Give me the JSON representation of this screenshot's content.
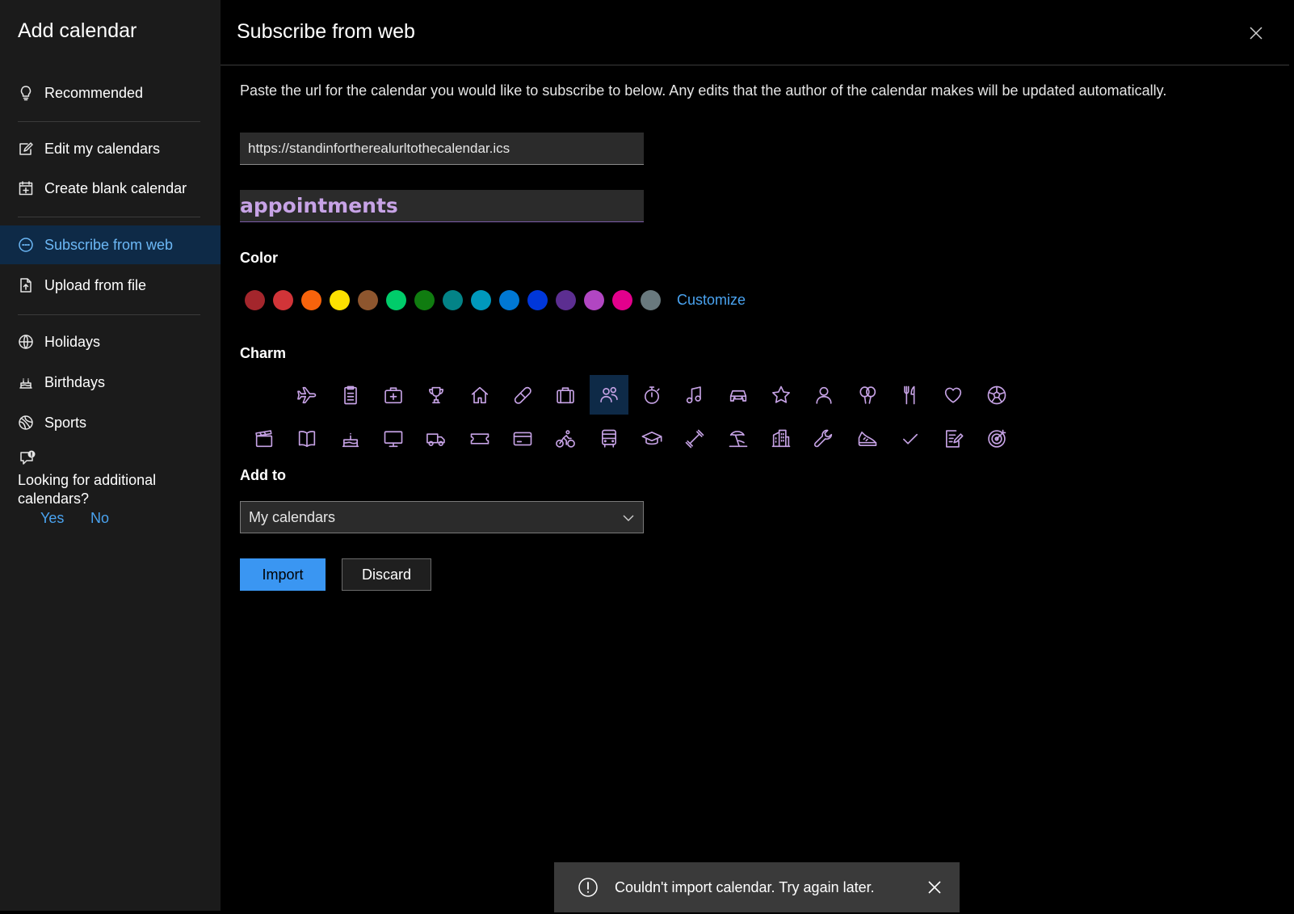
{
  "sidebar": {
    "title": "Add calendar",
    "items": [
      {
        "label": "Recommended",
        "icon": "lightbulb-icon"
      },
      {
        "label": "Edit my calendars",
        "icon": "edit-icon"
      },
      {
        "label": "Create blank calendar",
        "icon": "calendar-add-icon"
      },
      {
        "label": "Subscribe from web",
        "icon": "web-icon",
        "active": true
      },
      {
        "label": "Upload from file",
        "icon": "file-upload-icon"
      },
      {
        "label": "Holidays",
        "icon": "globe-icon"
      },
      {
        "label": "Birthdays",
        "icon": "cake-icon"
      },
      {
        "label": "Sports",
        "icon": "sports-ball-icon"
      }
    ],
    "feedback": {
      "question": "Looking for additional calendars?",
      "yes": "Yes",
      "no": "No"
    }
  },
  "dialog": {
    "title": "Subscribe from web",
    "description": "Paste the url for the calendar you would like to subscribe to below. Any edits that the author of the calendar makes will be updated automatically.",
    "url_value": "https://standinfortherealurltothecalendar.ics",
    "name_value": "appointments",
    "color_label": "Color",
    "colors": [
      "#a4262c",
      "#d13438",
      "#f7630c",
      "#fce100",
      "#8e562e",
      "#00cc6a",
      "#107c10",
      "#038387",
      "#0099bc",
      "#0078d4",
      "#0037da",
      "#5c2e91",
      "#b146c2",
      "#e3008c",
      "#69797e"
    ],
    "customize_label": "Customize",
    "charm_label": "Charm",
    "charms_row1": [
      "none",
      "airplane",
      "clipboard",
      "medical-kit",
      "trophy",
      "home",
      "bandage",
      "briefcase",
      "people",
      "stopwatch",
      "music-note",
      "car",
      "star",
      "person",
      "balloons",
      "fork-knife",
      "heart",
      "soccer-ball"
    ],
    "charms_row2": [
      "film-clapper",
      "book",
      "birthday-cake",
      "monitor",
      "truck",
      "ticket",
      "credit-card",
      "cyclist",
      "bus",
      "graduation-cap",
      "dumbbell",
      "beach",
      "building",
      "wrench",
      "sneaker",
      "checkmark",
      "document-edit",
      "target"
    ],
    "selected_charm": "people",
    "add_to_label": "Add to",
    "add_to_value": "My calendars",
    "import_label": "Import",
    "discard_label": "Discard"
  },
  "toast": {
    "message": "Couldn't import calendar. Try again later."
  },
  "accent": "#3a96f2",
  "charm_color": "#c7a3e6"
}
